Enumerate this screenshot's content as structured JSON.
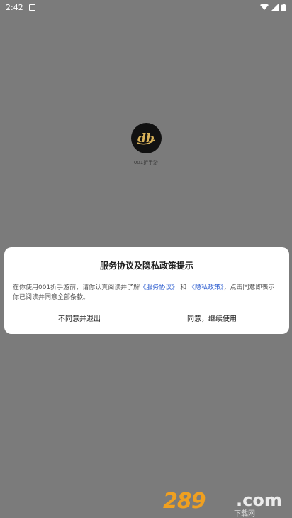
{
  "status_bar": {
    "time": "2:42",
    "icons": [
      "notification-icon",
      "wifi-icon",
      "signal-icon",
      "battery-icon"
    ]
  },
  "app": {
    "name": "001折手游",
    "logo_text": "db"
  },
  "dialog": {
    "title": "服务协议及隐私政策提示",
    "body_before": "在你使用001折手游前，请你认真阅读并了解",
    "service_link": "《服务协议》",
    "and_text": "和",
    "privacy_link": "《隐私政策》",
    "body_after": "，点击同意即表示你已阅读并同意全部条款。",
    "decline_label": "不同意并退出",
    "accept_label": "同意，继续使用"
  },
  "watermark": {
    "number": "289",
    "suffix": ".com",
    "sub": "下载网"
  },
  "colors": {
    "overlay_bg": "#7b7b7b",
    "link": "#2f5fd0",
    "watermark_orange": "#f0a020"
  }
}
